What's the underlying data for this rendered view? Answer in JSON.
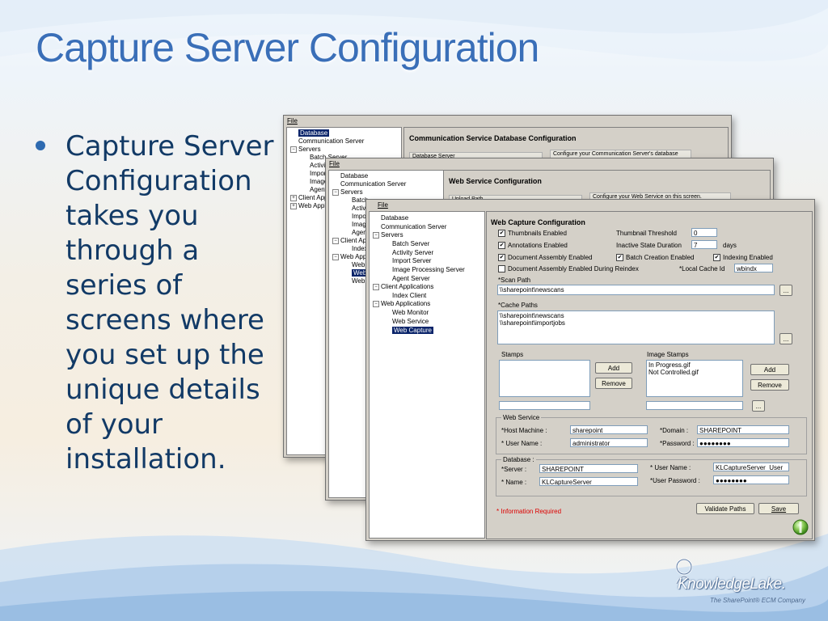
{
  "slide": {
    "title": "Capture Server Configuration",
    "bullet": "Capture Server Configuration takes you through a series of screens where you set up the unique details of your installation."
  },
  "logo": {
    "name": "KnowledgeLake.",
    "tagline": "The SharePoint® ECM Company"
  },
  "window_back": {
    "menu": "File",
    "tree": [
      "Database",
      "Communication Server",
      "Servers",
      "Batch Server",
      "Activity",
      "Import",
      "Image",
      "Agent",
      "Client App",
      "Web Appl"
    ],
    "panel_title": "Communication Service Database Configuration",
    "strip_left": "Database Server",
    "strip_right": "Configure your Communication Server's database"
  },
  "window_mid": {
    "menu": "File",
    "tree": [
      "Database",
      "Communication Server",
      "Servers",
      "Batch",
      "Activity",
      "Import",
      "Image",
      "Agent",
      "Client Appl",
      "Index I",
      "Web Appl",
      "Web M",
      "Web S",
      "Web C"
    ],
    "panel_title": "Web Service Configuration",
    "strip_left": "Upload Path",
    "strip_right": "Configure your Web Service on this screen."
  },
  "window_front": {
    "menu": "File",
    "tree": {
      "database": "Database",
      "comm_server": "Communication Server",
      "servers": "Servers",
      "batch_server": "Batch Server",
      "activity_server": "Activity Server",
      "import_server": "Import Server",
      "image_processing_server": "Image Processing Server",
      "agent_server": "Agent Server",
      "client_apps": "Client Applications",
      "index_client": "Index Client",
      "web_apps": "Web Applications",
      "web_monitor": "Web Monitor",
      "web_service": "Web Service",
      "web_capture": "Web Capture"
    },
    "config": {
      "title": "Web Capture Configuration",
      "thumbnails_enabled": "Thumbnails Enabled",
      "annotations_enabled": "Annotations Enabled",
      "doc_assembly_enabled": "Document Assembly Enabled",
      "doc_assembly_reindex": "Document Assembly Enabled During Reindex",
      "thumbnail_threshold_label": "Thumbnail Threshold",
      "thumbnail_threshold_value": "0",
      "inactive_state_label": "Inactive State Duration",
      "inactive_state_value": "7",
      "inactive_state_unit": "days",
      "batch_creation_enabled": "Batch Creation Enabled",
      "indexing_enabled": "Indexing Enabled",
      "local_cache_label": "*Local Cache Id",
      "local_cache_value": "wbindx",
      "scan_path_label": "*Scan Path",
      "scan_path_value": "\\\\sharepoint\\newscans",
      "cache_paths_label": "*Cache Paths",
      "cache_paths_value": "\\\\sharepoint\\newscans\n\\\\sharepoint\\importjobs",
      "browse_label": "...",
      "stamps_label": "Stamps",
      "image_stamps_label": "Image Stamps",
      "image_stamps_value": "In Progress.gif\nNot Controlled.gif",
      "add_label": "Add",
      "remove_label": "Remove",
      "web_service_group": "Web Service",
      "host_machine_label": "*Host Machine :",
      "host_machine_value": "sharepoint",
      "ws_domain_label": "*Domain :",
      "ws_domain_value": "SHAREPOINT",
      "ws_user_label": "* User Name :",
      "ws_user_value": "administrator",
      "ws_password_label": "*Password :",
      "ws_password_value": "●●●●●●●●",
      "database_group": "Database :",
      "db_server_label": "*Server :",
      "db_server_value": "SHAREPOINT",
      "db_user_label": "* User Name :",
      "db_user_value": "KLCaptureServer_User",
      "db_name_label": "* Name :",
      "db_name_value": "KLCaptureServer",
      "db_password_label": "*User Password :",
      "db_password_value": "●●●●●●●●",
      "required_note": "* Information Required",
      "validate_label": "Validate Paths",
      "save_label": "Save"
    }
  }
}
